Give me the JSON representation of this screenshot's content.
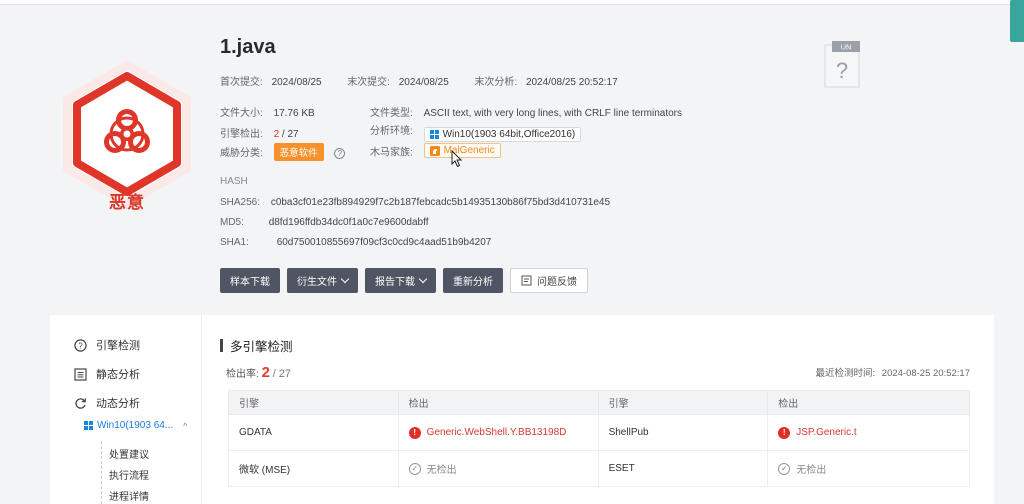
{
  "file": {
    "name": "1.java",
    "verdict": "恶意",
    "first_submit_label": "首次提交:",
    "first_submit": "2024/08/25",
    "last_submit_label": "末次提交:",
    "last_submit": "2024/08/25",
    "last_analysis_label": "末次分析:",
    "last_analysis": "2024/08/25 20:52:17",
    "size_label": "文件大小:",
    "size": "17.76 KB",
    "type_label": "文件类型:",
    "type": "ASCII text, with very long lines, with CRLF line terminators",
    "engine_label": "引擎检出:",
    "engine_hits": "2",
    "engine_total": "/ 27",
    "env_label": "分析环境:",
    "env": "Win10(1903 64bit,Office2016)",
    "threat_label": "威胁分类:",
    "threat": "恶意软件",
    "family_label": "木马家族:",
    "family": "MalGeneric",
    "unknown_tag": "UN"
  },
  "hash": {
    "title": "HASH",
    "sha256_label": "SHA256:",
    "sha256": "c0ba3cf01e23fb894929f7c2b187febcadc5b14935130b86f75bd3d410731e45",
    "md5_label": "MD5:",
    "md5": "d8fd196ffdb34dc0f1a0c7e9600dabff",
    "sha1_label": "SHA1:",
    "sha1": "60d750010855697f09cf3c0cd9c4aad51b9b4207"
  },
  "actions": {
    "download_sample": "样本下载",
    "derived_files": "衍生文件",
    "report_download": "报告下载",
    "reanalyze": "重新分析",
    "feedback": "问题反馈"
  },
  "sidebar": {
    "engine": "引擎检测",
    "static": "静态分析",
    "dynamic": "动态分析",
    "env_short": "Win10(1903 64...",
    "leaf1": "处置建议",
    "leaf2": "执行流程",
    "leaf3": "进程详情"
  },
  "engines": {
    "title": "多引擎检测",
    "rate_label": "检出率:",
    "rate_hits": "2",
    "rate_total": "/ 27",
    "last_time_label": "最近检测时间:",
    "last_time": "2024-08-25 20:52:17",
    "headers": [
      "引擎",
      "检出",
      "引擎",
      "检出"
    ],
    "rows": [
      [
        "GDATA",
        "Generic.WebShell.Y.BB13198D",
        "ShellPub",
        "JSP.Generic.t"
      ],
      [
        "微软 (MSE)",
        "无检出",
        "ESET",
        "无检出"
      ]
    ]
  },
  "colors": {
    "danger": "#e0362a",
    "button": "#4f5563",
    "accent": "#1a7adf"
  }
}
